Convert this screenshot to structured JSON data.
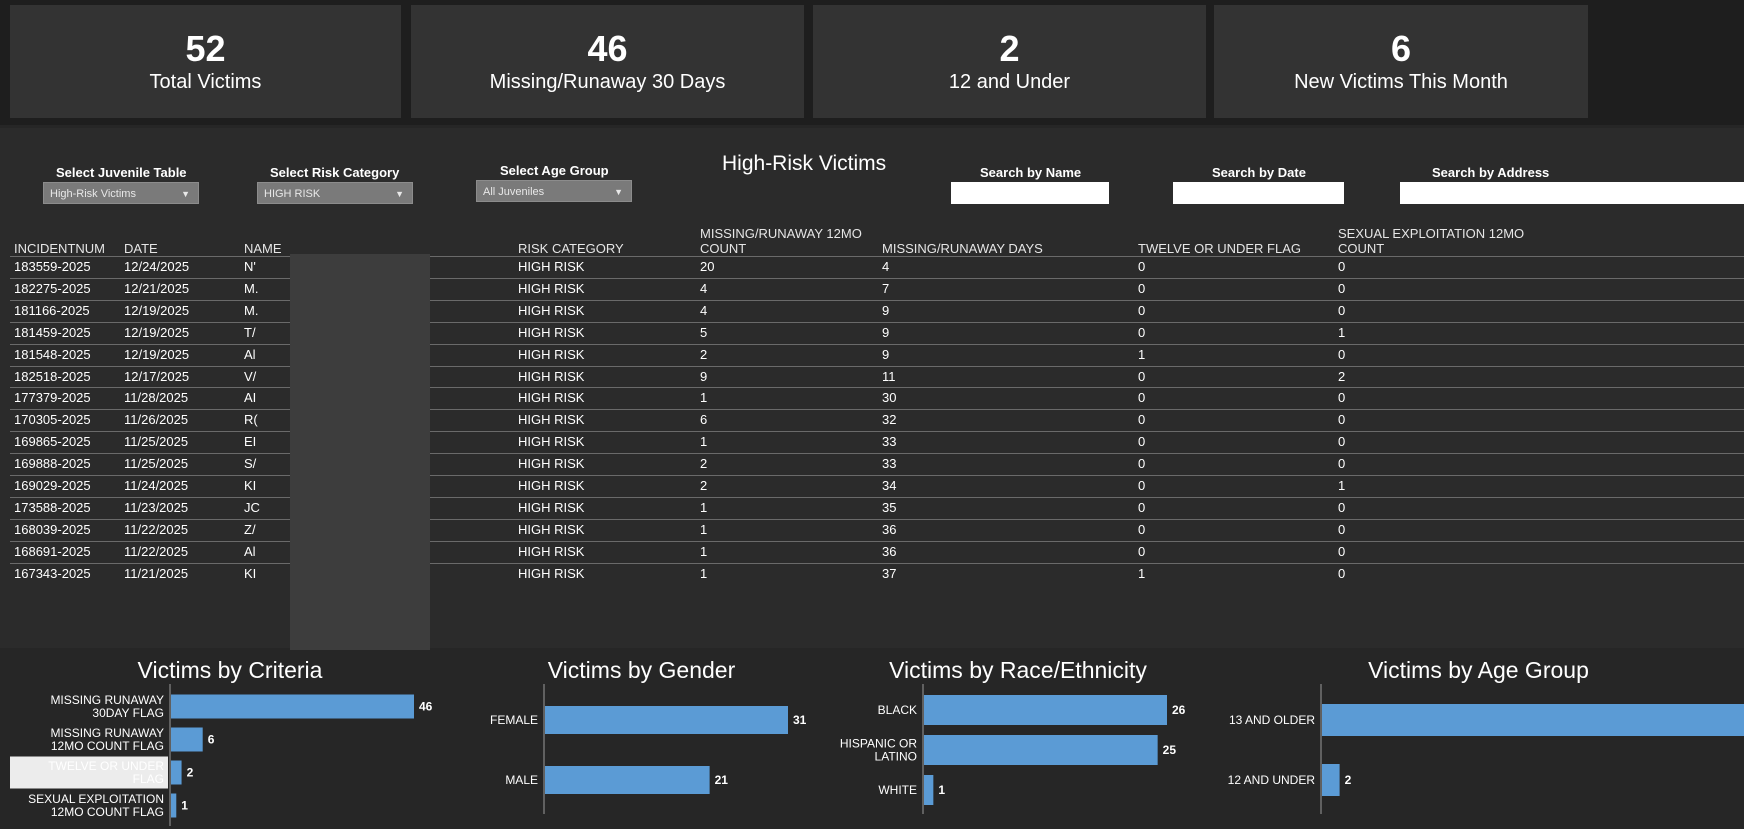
{
  "kpis": [
    {
      "value": "52",
      "label": "Total Victims"
    },
    {
      "value": "46",
      "label": "Missing/Runaway 30 Days"
    },
    {
      "value": "2",
      "label": "12 and Under"
    },
    {
      "value": "6",
      "label": "New Victims This Month"
    }
  ],
  "filters": {
    "juvenile_table": {
      "label": "Select Juvenile Table",
      "value": "High-Risk Victims"
    },
    "risk_category": {
      "label": "Select Risk Category",
      "value": "HIGH RISK"
    },
    "age_group": {
      "label": "Select Age Group",
      "value": "All Juveniles"
    }
  },
  "table_title": "High-Risk Victims",
  "search": {
    "name": "Search by Name",
    "date": "Search by Date",
    "address": "Search by Address"
  },
  "table": {
    "headers": {
      "incident": "INCIDENTNUM",
      "date": "DATE",
      "name": "NAME",
      "risk": "RISK CATEGORY",
      "mr12_line1": "MISSING/RUNAWAY 12MO",
      "mr12_line2": "COUNT",
      "mrdays": "MISSING/RUNAWAY DAYS",
      "twelve": "TWELVE OR UNDER FLAG",
      "se12_line1": "SEXUAL EXPLOITATION 12MO",
      "se12_line2": "COUNT"
    },
    "rows": [
      {
        "incident": "183559-2025",
        "date": "12/24/2025",
        "name": "N'",
        "risk": "HIGH RISK",
        "mr12": "20",
        "mrdays": "4",
        "twelve": "0",
        "se12": "0"
      },
      {
        "incident": "182275-2025",
        "date": "12/21/2025",
        "name": "M.",
        "risk": "HIGH RISK",
        "mr12": "4",
        "mrdays": "7",
        "twelve": "0",
        "se12": "0"
      },
      {
        "incident": "181166-2025",
        "date": "12/19/2025",
        "name": "M.",
        "risk": "HIGH RISK",
        "mr12": "4",
        "mrdays": "9",
        "twelve": "0",
        "se12": "0"
      },
      {
        "incident": "181459-2025",
        "date": "12/19/2025",
        "name": "T/",
        "risk": "HIGH RISK",
        "mr12": "5",
        "mrdays": "9",
        "twelve": "0",
        "se12": "1"
      },
      {
        "incident": "181548-2025",
        "date": "12/19/2025",
        "name": "Al",
        "risk": "HIGH RISK",
        "mr12": "2",
        "mrdays": "9",
        "twelve": "1",
        "se12": "0"
      },
      {
        "incident": "182518-2025",
        "date": "12/17/2025",
        "name": "V/",
        "risk": "HIGH RISK",
        "mr12": "9",
        "mrdays": "11",
        "twelve": "0",
        "se12": "2"
      },
      {
        "incident": "177379-2025",
        "date": "11/28/2025",
        "name": "AI",
        "risk": "HIGH RISK",
        "mr12": "1",
        "mrdays": "30",
        "twelve": "0",
        "se12": "0"
      },
      {
        "incident": "170305-2025",
        "date": "11/26/2025",
        "name": "R(",
        "risk": "HIGH RISK",
        "mr12": "6",
        "mrdays": "32",
        "twelve": "0",
        "se12": "0"
      },
      {
        "incident": "169865-2025",
        "date": "11/25/2025",
        "name": "EI",
        "risk": "HIGH RISK",
        "mr12": "1",
        "mrdays": "33",
        "twelve": "0",
        "se12": "0"
      },
      {
        "incident": "169888-2025",
        "date": "11/25/2025",
        "name": "S/",
        "risk": "HIGH RISK",
        "mr12": "2",
        "mrdays": "33",
        "twelve": "0",
        "se12": "0"
      },
      {
        "incident": "169029-2025",
        "date": "11/24/2025",
        "name": "KI",
        "risk": "HIGH RISK",
        "mr12": "2",
        "mrdays": "34",
        "twelve": "0",
        "se12": "1"
      },
      {
        "incident": "173588-2025",
        "date": "11/23/2025",
        "name": "JC",
        "risk": "HIGH RISK",
        "mr12": "1",
        "mrdays": "35",
        "twelve": "0",
        "se12": "0"
      },
      {
        "incident": "168039-2025",
        "date": "11/22/2025",
        "name": "Z/",
        "risk": "HIGH RISK",
        "mr12": "1",
        "mrdays": "36",
        "twelve": "0",
        "se12": "0"
      },
      {
        "incident": "168691-2025",
        "date": "11/22/2025",
        "name": "Al",
        "risk": "HIGH RISK",
        "mr12": "1",
        "mrdays": "36",
        "twelve": "0",
        "se12": "0"
      },
      {
        "incident": "167343-2025",
        "date": "11/21/2025",
        "name": "KI",
        "risk": "HIGH RISK",
        "mr12": "1",
        "mrdays": "37",
        "twelve": "1",
        "se12": "0"
      }
    ]
  },
  "colors": {
    "bar": "#5b9bd5",
    "panel": "#333333",
    "background": "#262626"
  },
  "chart_data": [
    {
      "type": "bar",
      "orientation": "horizontal",
      "title": "Victims by Criteria",
      "categories": [
        [
          "MISSING RUNAWAY",
          "30DAY FLAG"
        ],
        [
          "MISSING RUNAWAY",
          "12MO COUNT FLAG"
        ],
        [
          "TWELVE OR UNDER",
          "FLAG"
        ],
        [
          "SEXUAL EXPLOITATION",
          "12MO COUNT FLAG"
        ]
      ],
      "values": [
        46,
        6,
        2,
        1
      ],
      "highlighted_category": 2
    },
    {
      "type": "bar",
      "orientation": "horizontal",
      "title": "Victims by Gender",
      "categories": [
        [
          "FEMALE"
        ],
        [
          "MALE"
        ]
      ],
      "values": [
        31,
        21
      ]
    },
    {
      "type": "bar",
      "orientation": "horizontal",
      "title": "Victims by Race/Ethnicity",
      "categories": [
        [
          "BLACK"
        ],
        [
          "HISPANIC OR",
          "LATINO"
        ],
        [
          "WHITE"
        ]
      ],
      "values": [
        26,
        25,
        1
      ]
    },
    {
      "type": "bar",
      "orientation": "horizontal",
      "title": "Victims by Age Group",
      "categories": [
        [
          "13 AND OLDER"
        ],
        [
          "12 AND UNDER"
        ]
      ],
      "values": [
        50,
        2
      ],
      "value_labels": [
        "",
        "2"
      ]
    }
  ]
}
